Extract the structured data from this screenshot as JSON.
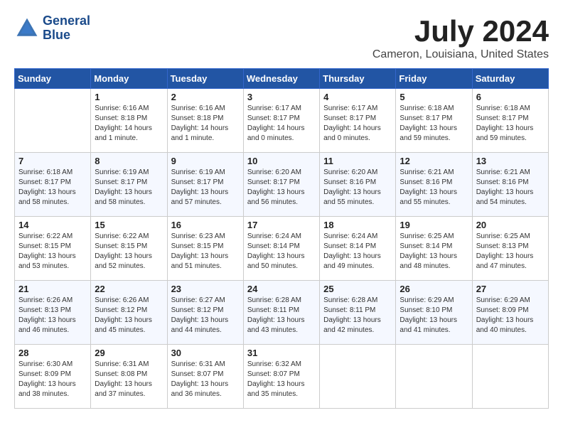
{
  "header": {
    "logo_line1": "General",
    "logo_line2": "Blue",
    "month_title": "July 2024",
    "location": "Cameron, Louisiana, United States"
  },
  "weekdays": [
    "Sunday",
    "Monday",
    "Tuesday",
    "Wednesday",
    "Thursday",
    "Friday",
    "Saturday"
  ],
  "weeks": [
    [
      {
        "day": "",
        "sunrise": "",
        "sunset": "",
        "daylight": ""
      },
      {
        "day": "1",
        "sunrise": "Sunrise: 6:16 AM",
        "sunset": "Sunset: 8:18 PM",
        "daylight": "Daylight: 14 hours and 1 minute."
      },
      {
        "day": "2",
        "sunrise": "Sunrise: 6:16 AM",
        "sunset": "Sunset: 8:18 PM",
        "daylight": "Daylight: 14 hours and 1 minute."
      },
      {
        "day": "3",
        "sunrise": "Sunrise: 6:17 AM",
        "sunset": "Sunset: 8:17 PM",
        "daylight": "Daylight: 14 hours and 0 minutes."
      },
      {
        "day": "4",
        "sunrise": "Sunrise: 6:17 AM",
        "sunset": "Sunset: 8:17 PM",
        "daylight": "Daylight: 14 hours and 0 minutes."
      },
      {
        "day": "5",
        "sunrise": "Sunrise: 6:18 AM",
        "sunset": "Sunset: 8:17 PM",
        "daylight": "Daylight: 13 hours and 59 minutes."
      },
      {
        "day": "6",
        "sunrise": "Sunrise: 6:18 AM",
        "sunset": "Sunset: 8:17 PM",
        "daylight": "Daylight: 13 hours and 59 minutes."
      }
    ],
    [
      {
        "day": "7",
        "sunrise": "Sunrise: 6:18 AM",
        "sunset": "Sunset: 8:17 PM",
        "daylight": "Daylight: 13 hours and 58 minutes."
      },
      {
        "day": "8",
        "sunrise": "Sunrise: 6:19 AM",
        "sunset": "Sunset: 8:17 PM",
        "daylight": "Daylight: 13 hours and 58 minutes."
      },
      {
        "day": "9",
        "sunrise": "Sunrise: 6:19 AM",
        "sunset": "Sunset: 8:17 PM",
        "daylight": "Daylight: 13 hours and 57 minutes."
      },
      {
        "day": "10",
        "sunrise": "Sunrise: 6:20 AM",
        "sunset": "Sunset: 8:17 PM",
        "daylight": "Daylight: 13 hours and 56 minutes."
      },
      {
        "day": "11",
        "sunrise": "Sunrise: 6:20 AM",
        "sunset": "Sunset: 8:16 PM",
        "daylight": "Daylight: 13 hours and 55 minutes."
      },
      {
        "day": "12",
        "sunrise": "Sunrise: 6:21 AM",
        "sunset": "Sunset: 8:16 PM",
        "daylight": "Daylight: 13 hours and 55 minutes."
      },
      {
        "day": "13",
        "sunrise": "Sunrise: 6:21 AM",
        "sunset": "Sunset: 8:16 PM",
        "daylight": "Daylight: 13 hours and 54 minutes."
      }
    ],
    [
      {
        "day": "14",
        "sunrise": "Sunrise: 6:22 AM",
        "sunset": "Sunset: 8:15 PM",
        "daylight": "Daylight: 13 hours and 53 minutes."
      },
      {
        "day": "15",
        "sunrise": "Sunrise: 6:22 AM",
        "sunset": "Sunset: 8:15 PM",
        "daylight": "Daylight: 13 hours and 52 minutes."
      },
      {
        "day": "16",
        "sunrise": "Sunrise: 6:23 AM",
        "sunset": "Sunset: 8:15 PM",
        "daylight": "Daylight: 13 hours and 51 minutes."
      },
      {
        "day": "17",
        "sunrise": "Sunrise: 6:24 AM",
        "sunset": "Sunset: 8:14 PM",
        "daylight": "Daylight: 13 hours and 50 minutes."
      },
      {
        "day": "18",
        "sunrise": "Sunrise: 6:24 AM",
        "sunset": "Sunset: 8:14 PM",
        "daylight": "Daylight: 13 hours and 49 minutes."
      },
      {
        "day": "19",
        "sunrise": "Sunrise: 6:25 AM",
        "sunset": "Sunset: 8:14 PM",
        "daylight": "Daylight: 13 hours and 48 minutes."
      },
      {
        "day": "20",
        "sunrise": "Sunrise: 6:25 AM",
        "sunset": "Sunset: 8:13 PM",
        "daylight": "Daylight: 13 hours and 47 minutes."
      }
    ],
    [
      {
        "day": "21",
        "sunrise": "Sunrise: 6:26 AM",
        "sunset": "Sunset: 8:13 PM",
        "daylight": "Daylight: 13 hours and 46 minutes."
      },
      {
        "day": "22",
        "sunrise": "Sunrise: 6:26 AM",
        "sunset": "Sunset: 8:12 PM",
        "daylight": "Daylight: 13 hours and 45 minutes."
      },
      {
        "day": "23",
        "sunrise": "Sunrise: 6:27 AM",
        "sunset": "Sunset: 8:12 PM",
        "daylight": "Daylight: 13 hours and 44 minutes."
      },
      {
        "day": "24",
        "sunrise": "Sunrise: 6:28 AM",
        "sunset": "Sunset: 8:11 PM",
        "daylight": "Daylight: 13 hours and 43 minutes."
      },
      {
        "day": "25",
        "sunrise": "Sunrise: 6:28 AM",
        "sunset": "Sunset: 8:11 PM",
        "daylight": "Daylight: 13 hours and 42 minutes."
      },
      {
        "day": "26",
        "sunrise": "Sunrise: 6:29 AM",
        "sunset": "Sunset: 8:10 PM",
        "daylight": "Daylight: 13 hours and 41 minutes."
      },
      {
        "day": "27",
        "sunrise": "Sunrise: 6:29 AM",
        "sunset": "Sunset: 8:09 PM",
        "daylight": "Daylight: 13 hours and 40 minutes."
      }
    ],
    [
      {
        "day": "28",
        "sunrise": "Sunrise: 6:30 AM",
        "sunset": "Sunset: 8:09 PM",
        "daylight": "Daylight: 13 hours and 38 minutes."
      },
      {
        "day": "29",
        "sunrise": "Sunrise: 6:31 AM",
        "sunset": "Sunset: 8:08 PM",
        "daylight": "Daylight: 13 hours and 37 minutes."
      },
      {
        "day": "30",
        "sunrise": "Sunrise: 6:31 AM",
        "sunset": "Sunset: 8:07 PM",
        "daylight": "Daylight: 13 hours and 36 minutes."
      },
      {
        "day": "31",
        "sunrise": "Sunrise: 6:32 AM",
        "sunset": "Sunset: 8:07 PM",
        "daylight": "Daylight: 13 hours and 35 minutes."
      },
      {
        "day": "",
        "sunrise": "",
        "sunset": "",
        "daylight": ""
      },
      {
        "day": "",
        "sunrise": "",
        "sunset": "",
        "daylight": ""
      },
      {
        "day": "",
        "sunrise": "",
        "sunset": "",
        "daylight": ""
      }
    ]
  ]
}
